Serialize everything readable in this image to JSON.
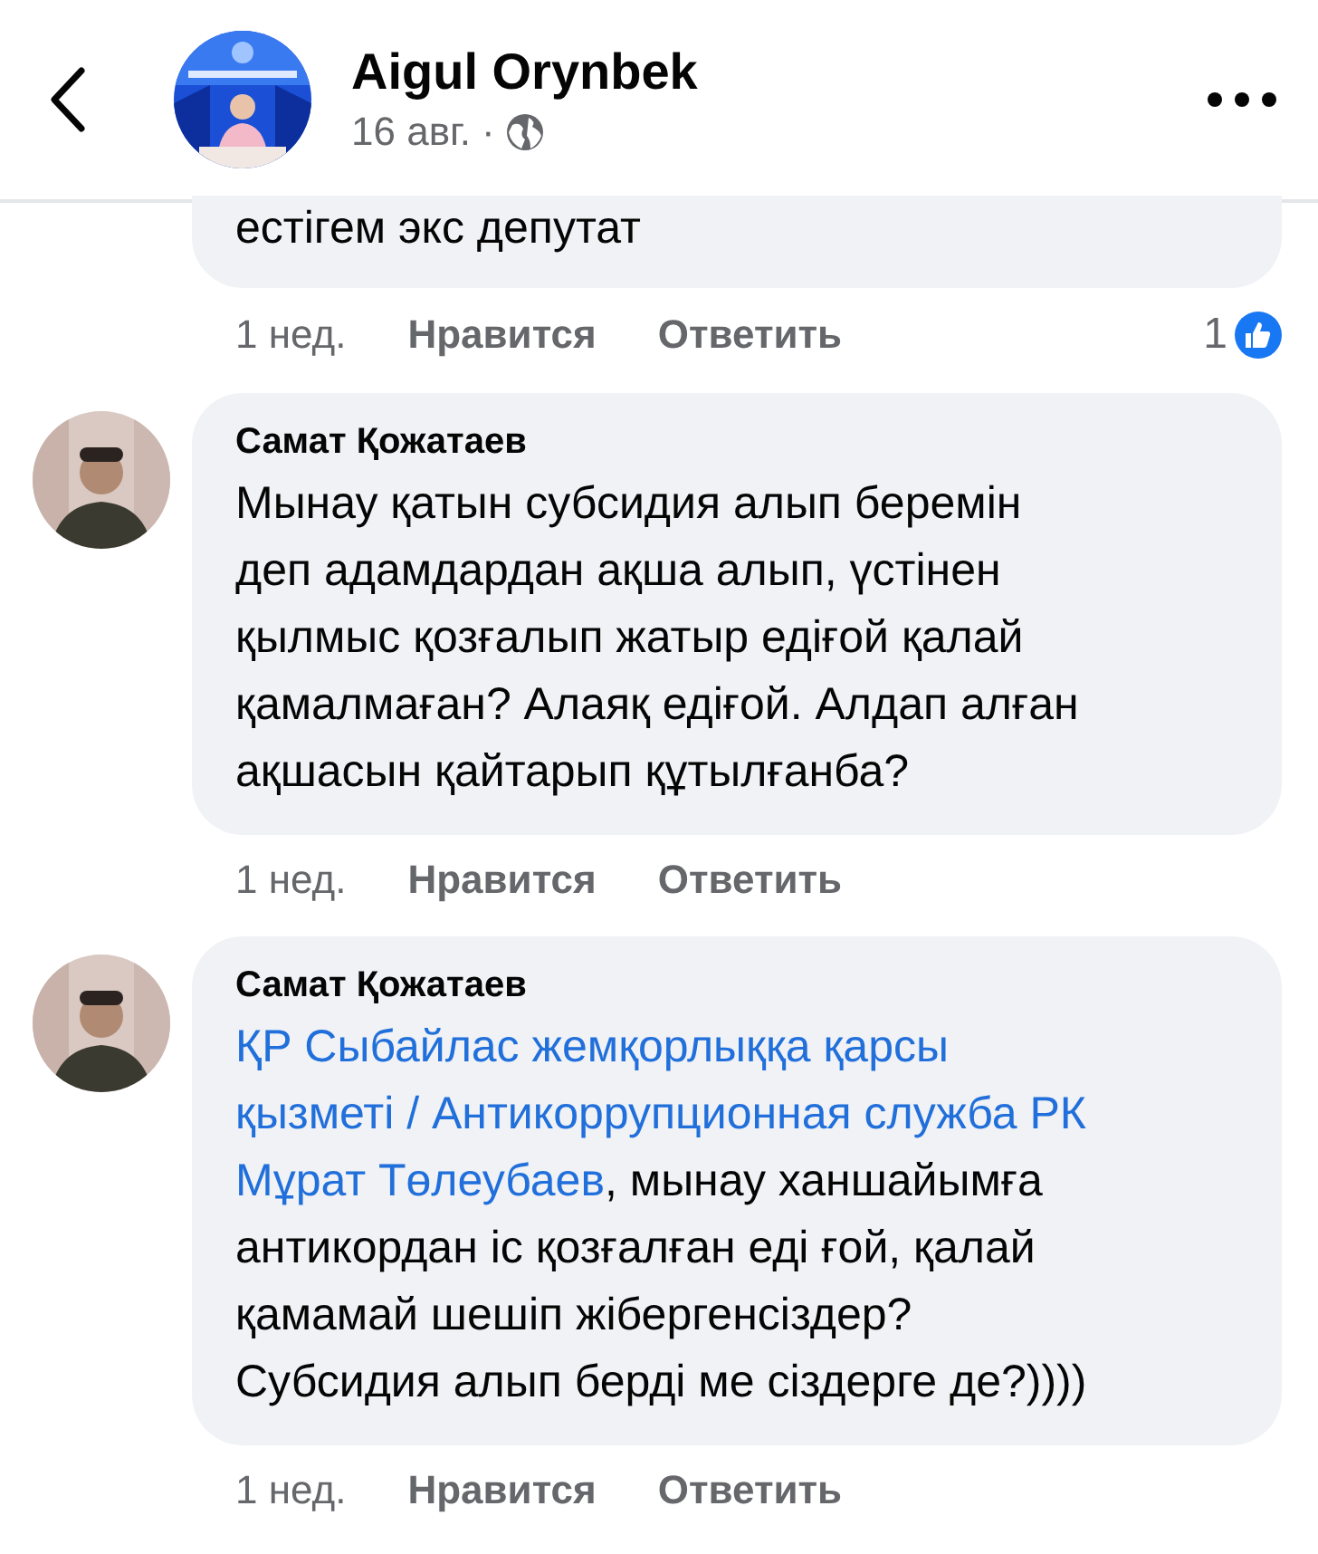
{
  "header": {
    "author": "Aigul Orynbek",
    "date": "16 авг.",
    "separator": "·"
  },
  "comments": [
    {
      "kind": "partial",
      "lines": [
        [
          {
            "kind": "text",
            "text": "естігем экс депутат"
          }
        ]
      ],
      "time": "1 нед.",
      "like": "Нравится",
      "reply": "Ответить",
      "reactions": "1"
    },
    {
      "kind": "full",
      "author": "Самат Қожатаев",
      "lines": [
        [
          {
            "kind": "text",
            "text": "Мынау қатын субсидия алып беремін"
          }
        ],
        [
          {
            "kind": "text",
            "text": "деп адамдардан ақша алып, үстінен"
          }
        ],
        [
          {
            "kind": "text",
            "text": "қылмыс қозғалып жатыр едіғой қалай"
          }
        ],
        [
          {
            "kind": "text",
            "text": "қамалмаған? Алаяқ едіғой. Алдап алған"
          }
        ],
        [
          {
            "kind": "text",
            "text": "ақшасын қайтарып құтылғанба?"
          }
        ]
      ],
      "time": "1 нед.",
      "like": "Нравится",
      "reply": "Ответить"
    },
    {
      "kind": "full",
      "author": "Самат Қожатаев",
      "lines": [
        [
          {
            "kind": "link",
            "text": "ҚР Сыбайлас жемқорлыққа қарсы"
          }
        ],
        [
          {
            "kind": "link",
            "text": "қызметі / Антикоррупционная служба РК"
          }
        ],
        [
          {
            "kind": "link",
            "text": "Мұрат Төлеубаев"
          },
          {
            "kind": "text",
            "text": ", мынау ханшайымға"
          }
        ],
        [
          {
            "kind": "text",
            "text": "антикордан іс қозғалған еді ғой, қалай"
          }
        ],
        [
          {
            "kind": "text",
            "text": "қамамай шешіп жібергенсіздер?"
          }
        ],
        [
          {
            "kind": "text",
            "text": "Субсидия алып берді ме сіздерге де?))))"
          }
        ]
      ],
      "time": "1 нед.",
      "like": "Нравится",
      "reply": "Ответить"
    }
  ]
}
